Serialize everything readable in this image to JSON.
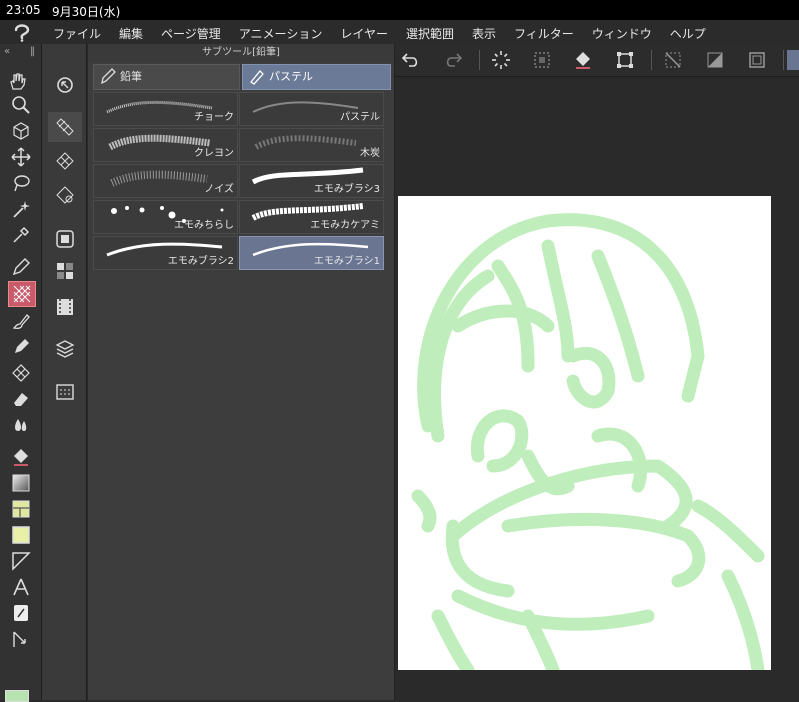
{
  "status": {
    "time": "23:05",
    "date": "9月30日(水)"
  },
  "menu": [
    "ファイル",
    "編集",
    "ページ管理",
    "アニメーション",
    "レイヤー",
    "選択範囲",
    "表示",
    "フィルター",
    "ウィンドウ",
    "ヘルプ"
  ],
  "subtool_panel": {
    "title": "サブツール[鉛筆]",
    "groups": [
      "鉛筆",
      "パステル"
    ],
    "selected_group": "パステル",
    "brushes": [
      "チョーク",
      "パステル",
      "クレヨン",
      "木炭",
      "ノイズ",
      "エモみブラシ3",
      "エモみちらし",
      "エモみカケアミ",
      "エモみブラシ2",
      "エモみブラシ1"
    ],
    "selected_brush": "エモみブラシ1"
  },
  "colors": {
    "accent": "#6a7591",
    "stroke": "#b7ebb3",
    "selected_tool": "#c95a6a"
  },
  "toolbar_icons": [
    "undo-icon",
    "redo-icon",
    "busy-icon",
    "select-all-icon",
    "fill-icon",
    "transform-icon",
    "deselect-icon",
    "invert-icon",
    "crop-icon"
  ]
}
